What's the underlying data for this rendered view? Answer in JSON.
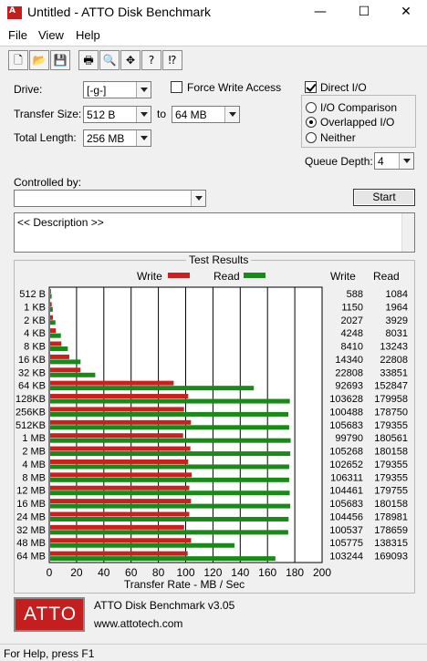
{
  "window": {
    "title": "Untitled - ATTO Disk Benchmark",
    "minimize": "—",
    "maximize": "☐",
    "close": "✕"
  },
  "menu": [
    "File",
    "View",
    "Help"
  ],
  "toolbar": [
    {
      "name": "new-icon",
      "glyph": "🗋"
    },
    {
      "name": "open-icon",
      "glyph": "📂"
    },
    {
      "name": "save-icon",
      "glyph": "💾"
    },
    {
      "name": "print-icon",
      "glyph": "🖶"
    },
    {
      "name": "print-preview-icon",
      "glyph": "🔍"
    },
    {
      "name": "move-icon",
      "glyph": "✥"
    },
    {
      "name": "help-icon",
      "glyph": "?"
    },
    {
      "name": "context-help-icon",
      "glyph": "⁉"
    }
  ],
  "form": {
    "drive_label": "Drive:",
    "drive_value": "[-g-]",
    "transfer_size_label": "Transfer Size:",
    "transfer_from": "512 B",
    "to_label": "to",
    "transfer_to": "64 MB",
    "total_length_label": "Total Length:",
    "total_length_value": "256 MB",
    "force_write_label": "Force Write Access",
    "force_write_checked": false,
    "direct_io_label": "Direct I/O",
    "direct_io_checked": true,
    "io_comparison_label": "I/O Comparison",
    "overlapped_io_label": "Overlapped I/O",
    "neither_label": "Neither",
    "io_mode": "overlapped",
    "queue_depth_label": "Queue Depth:",
    "queue_depth_value": "4",
    "controlled_by_label": "Controlled by:",
    "controlled_by_value": "",
    "start_label": "Start",
    "description_text": "<< Description >>"
  },
  "results": {
    "caption": "Test Results",
    "legend_write": "Write",
    "legend_read": "Read",
    "col_write": "Write",
    "col_read": "Read",
    "write_color": "#cc1f1f",
    "read_color": "#178a17"
  },
  "chart_data": {
    "type": "bar",
    "orientation": "horizontal",
    "xlabel": "Transfer Rate - MB / Sec",
    "xlim": [
      0,
      200
    ],
    "xticks": [
      0,
      20,
      40,
      60,
      80,
      100,
      120,
      140,
      160,
      180,
      200
    ],
    "grid": true,
    "legend_position": "top",
    "categories": [
      "512 B",
      "1 KB",
      "2 KB",
      "4 KB",
      "8 KB",
      "16 KB",
      "32 KB",
      "64 KB",
      "128KB",
      "256KB",
      "512KB",
      "1 MB",
      "2 MB",
      "4 MB",
      "8 MB",
      "12 MB",
      "16 MB",
      "24 MB",
      "32 MB",
      "48 MB",
      "64 MB"
    ],
    "series": [
      {
        "name": "Write",
        "values_mb_s": [
          0.57,
          1.12,
          1.98,
          4.15,
          8.21,
          14.0,
          22.27,
          90.52,
          101.2,
          98.14,
          103.2,
          97.45,
          102.8,
          101.2,
          103.8,
          102.0,
          103.2,
          102.0,
          98.18,
          103.3,
          100.8
        ]
      },
      {
        "name": "Read",
        "values_mb_s": [
          1.06,
          1.92,
          3.84,
          7.84,
          12.93,
          22.27,
          33.06,
          149.3,
          175.7,
          174.6,
          175.2,
          176.3,
          176.0,
          175.2,
          175.2,
          175.6,
          176.0,
          174.8,
          174.5,
          135.1,
          165.1
        ]
      }
    ],
    "table_write": [
      "588",
      "1150",
      "2027",
      "4248",
      "8410",
      "14340",
      "22808",
      "92693",
      "103628",
      "100488",
      "105683",
      "99790",
      "105268",
      "102652",
      "106311",
      "104461",
      "105683",
      "104456",
      "100537",
      "105775",
      "103244"
    ],
    "table_read": [
      "1084",
      "1964",
      "3929",
      "8031",
      "13243",
      "22808",
      "33851",
      "152847",
      "179958",
      "178750",
      "179355",
      "180561",
      "180158",
      "179355",
      "179355",
      "179755",
      "180158",
      "178981",
      "178659",
      "138315",
      "169093"
    ]
  },
  "footer": {
    "logo_text": "ATTO",
    "product": "ATTO Disk Benchmark v3.05",
    "website": "www.attotech.com"
  },
  "status": "For Help, press F1"
}
